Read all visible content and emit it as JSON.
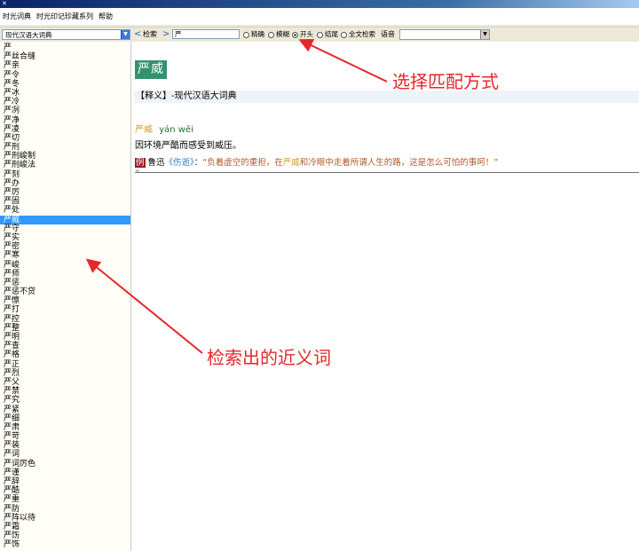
{
  "menu": [
    "时光词典",
    "时光印记珍藏系列",
    "帮助"
  ],
  "toolbar": {
    "dictionary": "现代汉语大词典",
    "nav_back": "<",
    "search_label": "检索",
    "nav_forward": ">",
    "search_value": "严",
    "match_options": [
      {
        "label": "精确",
        "checked": false
      },
      {
        "label": "模糊",
        "checked": false
      },
      {
        "label": "开头",
        "checked": true
      },
      {
        "label": "结尾",
        "checked": false
      },
      {
        "label": "全文检索",
        "checked": false
      }
    ],
    "audio_label": "语音",
    "audio_value": ""
  },
  "sidebar": {
    "selected_index": 19,
    "words": [
      "严",
      "严丝合缝",
      "严亲",
      "严令",
      "严冬",
      "严冰",
      "严冷",
      "严冽",
      "严净",
      "严凌",
      "严切",
      "严刑",
      "严刑峻制",
      "严刑峻法",
      "严刻",
      "严办",
      "严厉",
      "严固",
      "严处",
      "严威",
      "严守",
      "严实",
      "严密",
      "严寒",
      "严峻",
      "严师",
      "严惩",
      "严惩不贷",
      "严懔",
      "严打",
      "严控",
      "严整",
      "严明",
      "严查",
      "严格",
      "严正",
      "严烈",
      "严父",
      "严禁",
      "严究",
      "严紧",
      "严细",
      "严肃",
      "严苛",
      "严装",
      "严词",
      "严词厉色",
      "严谨",
      "严辞",
      "严酷",
      "严重",
      "严防",
      "严阵以待",
      "严霜",
      "严饬",
      "严饰"
    ]
  },
  "content": {
    "headword": "严威",
    "section_heading": "【释义】-现代汉语大词典",
    "entry_word": "严威",
    "pinyin": "yán wēi",
    "definition": "因环境严酷而感受到威压。",
    "example": {
      "tag": "例",
      "author": "鲁迅",
      "work": "《伤逝》",
      "colon": "：",
      "quote_before": "“负着虚空的重担，在",
      "quote_highlight": "严威",
      "quote_after": "和冷眼中走着所谓人生的路，这是怎么可怕的事呵！”"
    }
  },
  "annotations": {
    "match_mode": "选择匹配方式",
    "synonyms": "检索出的近义词",
    "color": "#e8272c"
  },
  "colors": {
    "headword_bg": "#32926e",
    "selected_row": "#3399ff",
    "example_tag_bg": "#a01e22",
    "pinyin": "#21722c",
    "entry_word": "#d39c27"
  }
}
